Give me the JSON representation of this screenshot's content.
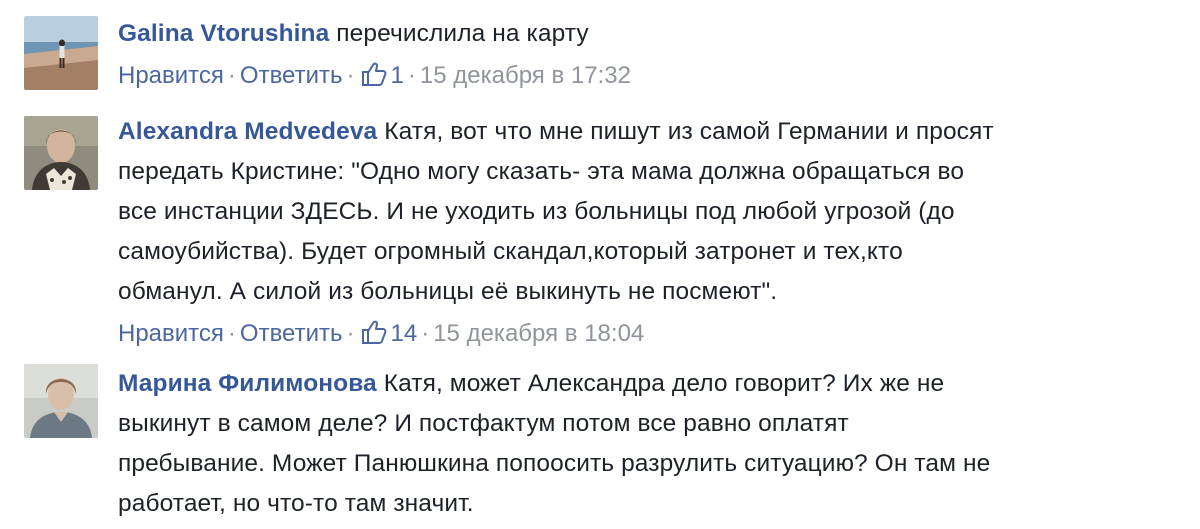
{
  "comments": [
    {
      "author": "Galina Vtorushina",
      "text": "перечислила на карту",
      "actions": {
        "like": "Нравится",
        "reply": "Ответить",
        "separator": "·",
        "likes": "1",
        "time": "15 декабря в 17:32"
      },
      "avatar_icon": "beach-photo-avatar"
    },
    {
      "author": "Alexandra Medvedeva",
      "text_lines": [
        "Катя, вот что мне пишут из самой Германии и просят",
        "передать Кристине: \"Одно могу сказать- эта мама должна обращаться во",
        "все инстанции ЗДЕСЬ. И не уходить из больницы под любой угрозой (до",
        "самоубийства). Будет огромный скандал,который затронет и тех,кто",
        "обманул. А силой из больницы её выкинуть не посмеют\"."
      ],
      "actions": {
        "like": "Нравится",
        "reply": "Ответить",
        "separator": "·",
        "likes": "14",
        "time": "15 декабря в 18:04"
      },
      "avatar_icon": "woman-photo-avatar"
    },
    {
      "author": "Марина Филимонова",
      "text_lines": [
        "Катя, может Александра дело говорит? Их же не",
        "выкинут в самом деле? И постфактум потом все равно оплатят",
        "пребывание. Может Панюшкина попоосить разрулить ситуацию? Он там не",
        "работает, но что-то там значит."
      ],
      "avatar_icon": "woman-photo-avatar"
    }
  ],
  "colors": {
    "author": "#365899",
    "link": "#4b67a1",
    "muted": "#90949c",
    "text": "#1d2129"
  }
}
